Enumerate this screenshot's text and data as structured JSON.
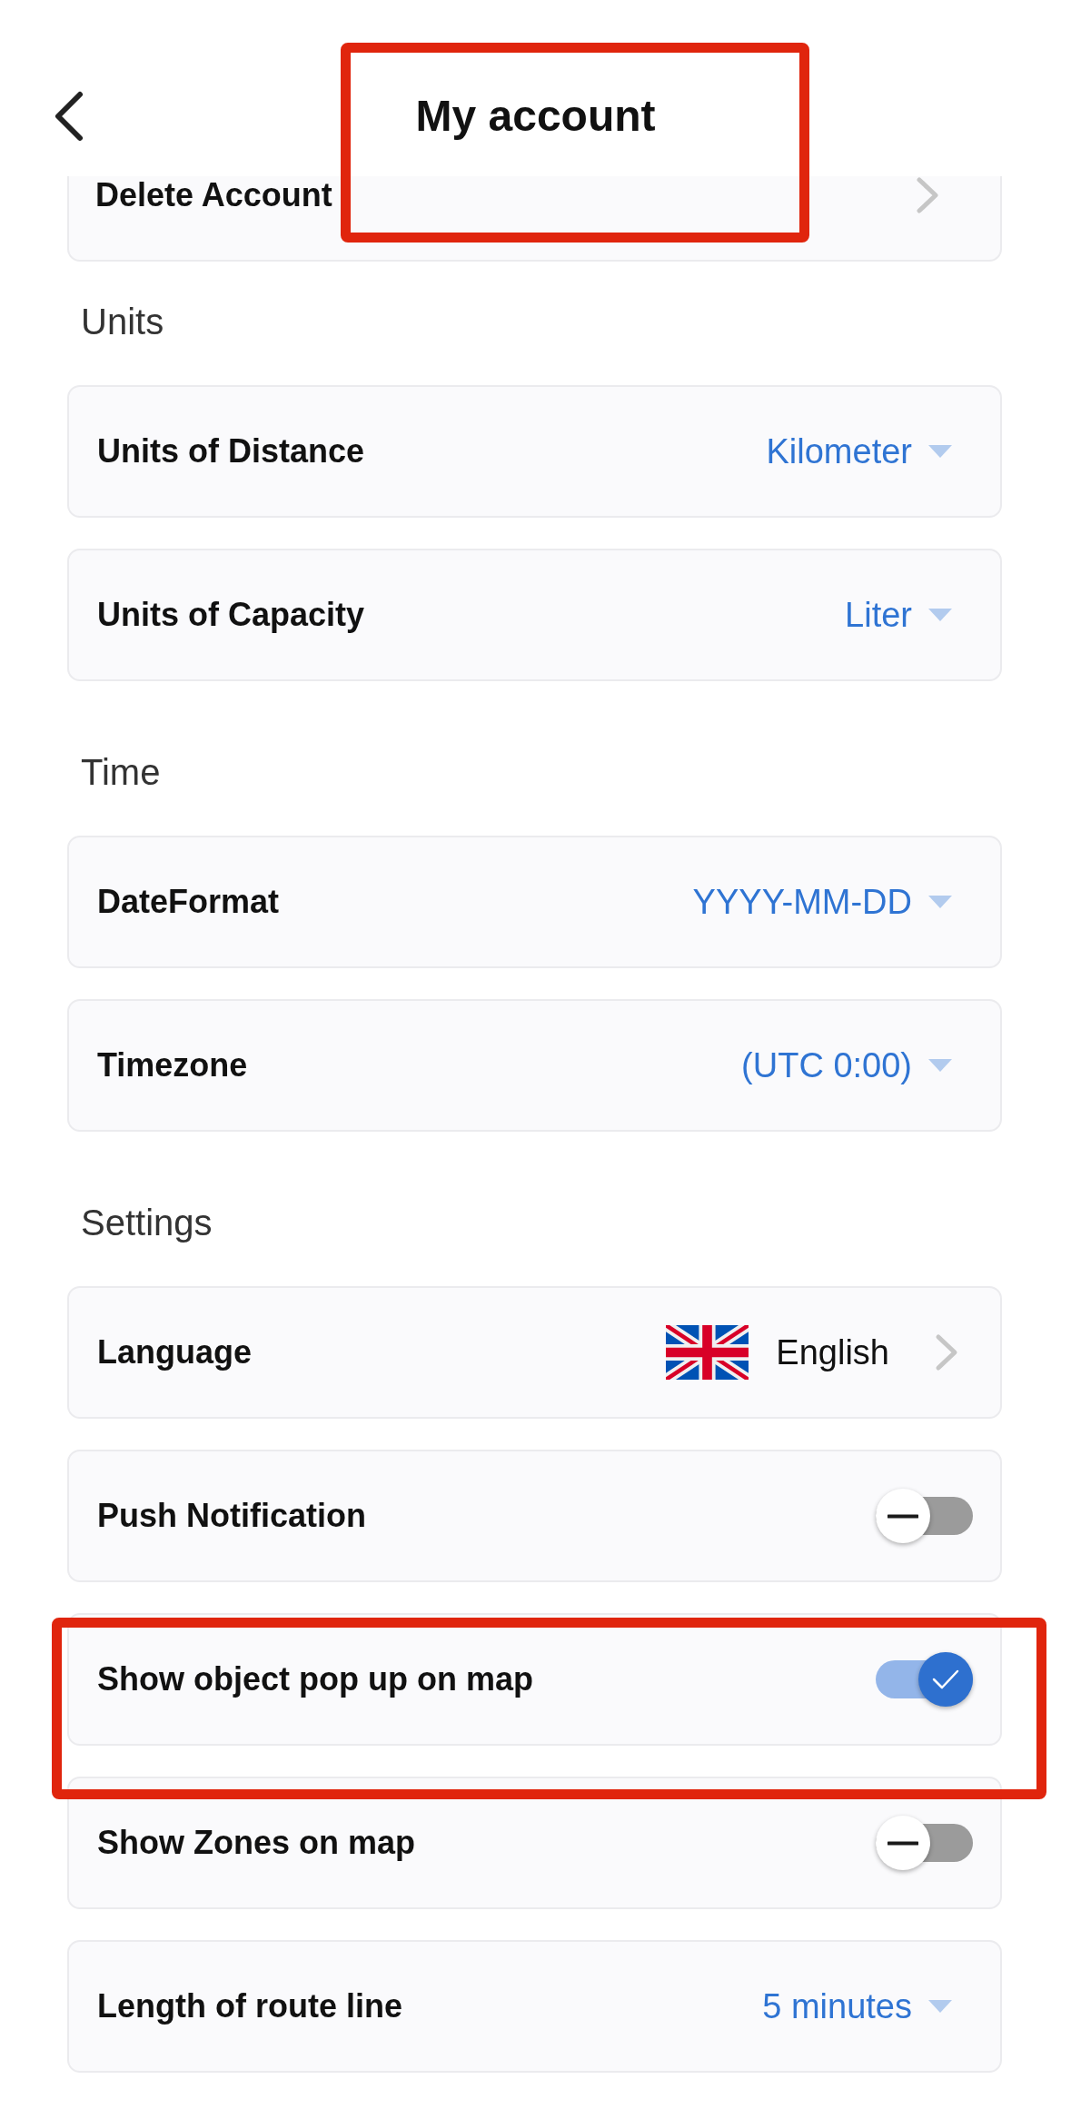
{
  "header": {
    "title": "My account",
    "highlighted": true
  },
  "sections": [
    {
      "items": [
        {
          "kind": "link",
          "label": "Delete Account",
          "highlighted": false
        }
      ]
    },
    {
      "title": "Units",
      "items": [
        {
          "kind": "dropdown",
          "label": "Units of Distance",
          "value": "Kilometer",
          "highlighted": false
        },
        {
          "kind": "dropdown",
          "label": "Units of Capacity",
          "value": "Liter",
          "highlighted": false
        }
      ]
    },
    {
      "title": "Time",
      "items": [
        {
          "kind": "dropdown",
          "label": "DateFormat",
          "value": "YYYY-MM-DD",
          "highlighted": false
        },
        {
          "kind": "dropdown",
          "label": "Timezone",
          "value": "(UTC 0:00)",
          "highlighted": false
        }
      ]
    },
    {
      "title": "Settings",
      "items": [
        {
          "kind": "language",
          "label": "Language",
          "value": "English",
          "highlighted": false
        },
        {
          "kind": "toggle",
          "label": "Push Notification",
          "on": false,
          "highlighted": false
        },
        {
          "kind": "toggle",
          "label": "Show object pop up on map",
          "on": true,
          "highlighted": true
        },
        {
          "kind": "toggle",
          "label": "Show Zones on map",
          "on": false,
          "highlighted": false
        },
        {
          "kind": "dropdown",
          "label": "Length of route line",
          "value": "5 minutes",
          "highlighted": false
        }
      ]
    }
  ]
}
